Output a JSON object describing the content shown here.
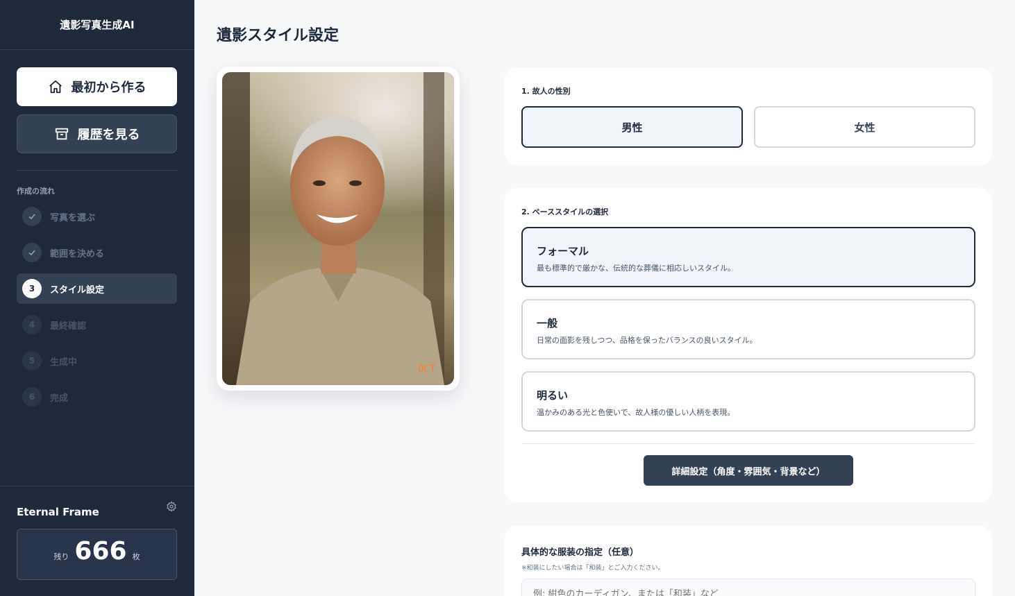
{
  "sidebar": {
    "title": "遺影写真生成AI",
    "primary_button": "最初から作る",
    "secondary_button": "履歴を見る",
    "flow_label": "作成の流れ",
    "steps": [
      {
        "num": "",
        "label": "写真を選ぶ",
        "state": "done"
      },
      {
        "num": "",
        "label": "範囲を決める",
        "state": "done"
      },
      {
        "num": "3",
        "label": "スタイル設定",
        "state": "active"
      },
      {
        "num": "4",
        "label": "最終確認",
        "state": "todo"
      },
      {
        "num": "5",
        "label": "生成中",
        "state": "todo"
      },
      {
        "num": "6",
        "label": "完成",
        "state": "todo"
      }
    ],
    "brand": "Eternal Frame",
    "credits_prefix": "残り",
    "credits_value": "666",
    "credits_suffix": "枚"
  },
  "main": {
    "title": "遺影スタイル設定",
    "photo_stamp": "OCT",
    "gender": {
      "label": "1. 故人の性別",
      "options": [
        "男性",
        "女性"
      ],
      "selected": "男性"
    },
    "style": {
      "label": "2. ベーススタイルの選択",
      "options": [
        {
          "title": "フォーマル",
          "desc": "最も標準的で厳かな、伝統的な葬儀に相応しいスタイル。"
        },
        {
          "title": "一般",
          "desc": "日常の面影を残しつつ、品格を保ったバランスの良いスタイル。"
        },
        {
          "title": "明るい",
          "desc": "温かみのある光と色使いで、故人様の優しい人柄を表現。"
        }
      ],
      "selected": "フォーマル",
      "advanced_button": "詳細設定（角度・雰囲気・背景など）"
    },
    "outfit": {
      "title": "具体的な服装の指定（任意）",
      "note": "※和装にしたい場合は「和装」とご入力ください。",
      "placeholder": "例: 紺色のカーディガン、または「和装」など"
    }
  },
  "colors": {
    "sidebar_bg": "#1e293b",
    "accent": "#334155",
    "page_bg": "#f7f8fa"
  }
}
